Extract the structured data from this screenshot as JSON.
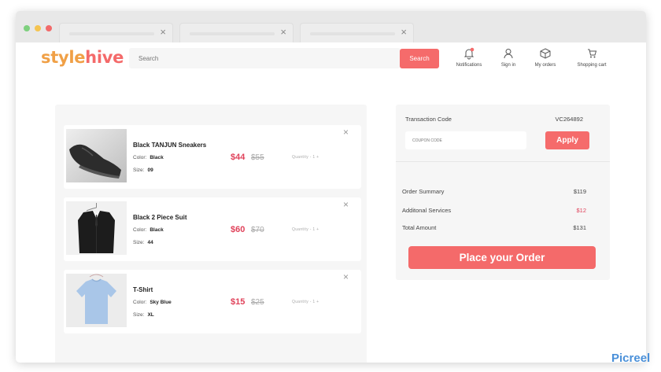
{
  "brand": {
    "name_part1": "style",
    "name_part2": "hive"
  },
  "header": {
    "search_placeholder": "Search",
    "search_button": "Search",
    "nav": [
      {
        "label": "Notifications",
        "icon": "bell-icon"
      },
      {
        "label": "Sign in",
        "icon": "user-icon"
      },
      {
        "label": "My orders",
        "icon": "box-icon"
      },
      {
        "label": "Shopping cart",
        "icon": "cart-icon"
      }
    ]
  },
  "cart": {
    "items": [
      {
        "name": "Black TANJUN Sneakers",
        "color_label": "Color:",
        "color": "Black",
        "size_label": "Size:",
        "size": "09",
        "price": "$44",
        "old_price": "$55",
        "qty_text": "Quantity  -  1  +"
      },
      {
        "name": "Black 2 Piece Suit",
        "color_label": "Color:",
        "color": "Black",
        "size_label": "Size:",
        "size": "44",
        "price": "$60",
        "old_price": "$70",
        "qty_text": "Quantity  -  1  +"
      },
      {
        "name": "T-Shirt",
        "color_label": "Color:",
        "color": "Sky Blue",
        "size_label": "Size:",
        "size": "XL",
        "price": "$15",
        "old_price": "$25",
        "qty_text": "Quantity  -  1  +"
      }
    ]
  },
  "summary": {
    "transaction_label": "Transaction Code",
    "transaction_code": "VC264892",
    "coupon_placeholder": "COUPON CODE",
    "apply_label": "Apply",
    "order_summary_label": "Order Summary",
    "order_summary_value": "$119",
    "services_label": "Additonal Services",
    "services_value": "$12",
    "total_label": "Total Amount",
    "total_value": "$131",
    "place_order_label": "Place your Order"
  },
  "watermark": "Picreel",
  "colors": {
    "accent": "#f56b6b",
    "price": "#e0425a",
    "logo_orange": "#f0a046",
    "watermark": "#4a90d9"
  }
}
